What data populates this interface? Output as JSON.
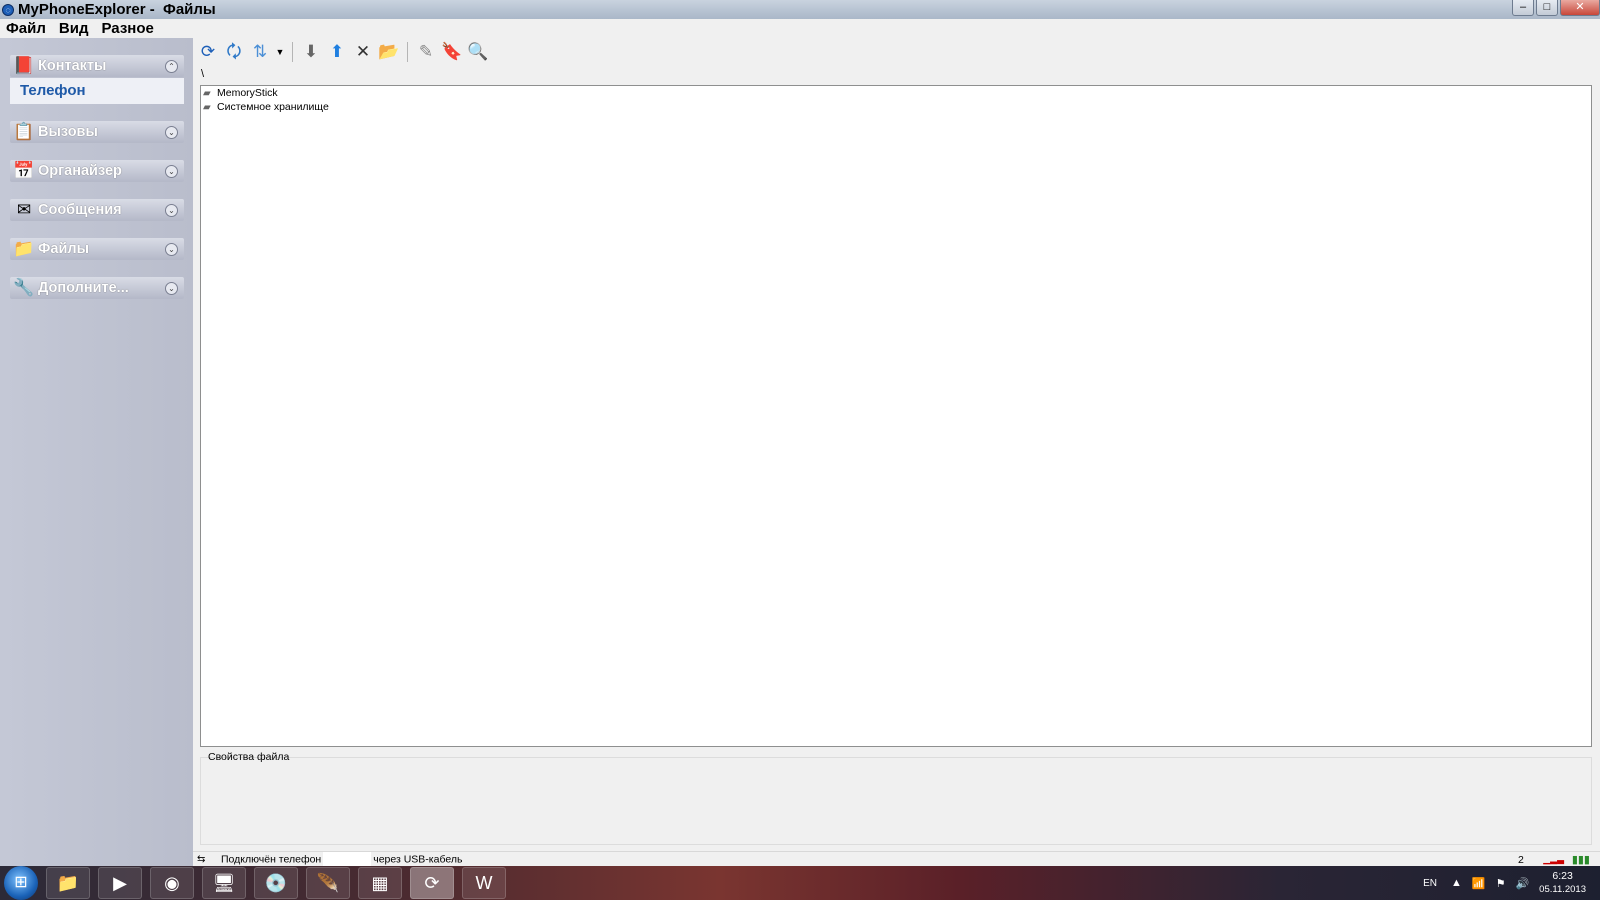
{
  "window": {
    "title": "MyPhoneExplorer -  Файлы",
    "controls": {
      "minimize": "–",
      "maximize": "□",
      "close": "✕"
    }
  },
  "menu": [
    "Файл",
    "Вид",
    "Разное"
  ],
  "sidebar": {
    "groups": [
      {
        "label": "Контакты",
        "icon": "contacts-book-icon",
        "expanded": true,
        "items": [
          "Телефон"
        ]
      },
      {
        "label": "Вызовы",
        "icon": "calls-icon"
      },
      {
        "label": "Органайзер",
        "icon": "organizer-icon"
      },
      {
        "label": "Сообщения",
        "icon": "messages-envelope-icon"
      },
      {
        "label": "Файлы",
        "icon": "folder-icon"
      },
      {
        "label": "Дополните...",
        "icon": "tools-icon"
      }
    ]
  },
  "toolbar": {
    "buttons": [
      "sync-icon",
      "refresh-icon",
      "sync-options-icon",
      "dropdown-arrow-icon",
      "download-icon",
      "upload-icon",
      "delete-icon",
      "new-folder-icon",
      "rename-icon",
      "bookmark-icon",
      "search-folder-icon"
    ]
  },
  "browser": {
    "path": "\\",
    "items": [
      {
        "name": "MemoryStick",
        "icon": "drive-icon"
      },
      {
        "name": "Системное хранилище",
        "icon": "drive-icon"
      }
    ]
  },
  "properties": {
    "label": "Свойства файла"
  },
  "status": {
    "text_before": "Подключён телефон",
    "text_after": "через USB-кабель",
    "count": "2"
  },
  "taskbar": {
    "apps": [
      "folder-icon",
      "media-player-icon",
      "chrome-icon",
      "device-manager-icon",
      "disc-icon",
      "feather-icon",
      "minecraft-icon",
      "myphoneexplorer-icon",
      "word-icon"
    ],
    "active": "myphoneexplorer-icon",
    "tray": {
      "lang": "EN",
      "time": "6:23",
      "date": "05.11.2013"
    }
  },
  "colors": {
    "sidebar": "#bec2d1",
    "accent": "#1f5aa8"
  }
}
